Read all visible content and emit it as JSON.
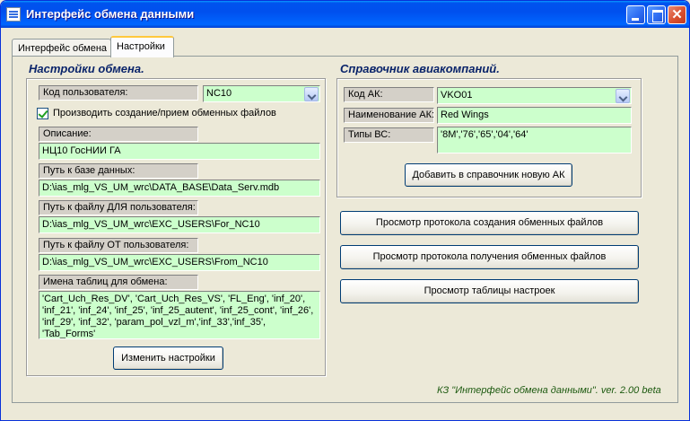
{
  "window": {
    "title": "Интерфейс обмена данными"
  },
  "tabs": [
    {
      "label": "Интерфейс обмена"
    },
    {
      "label": "Настройки"
    }
  ],
  "exchange_settings": {
    "title": "Настройки обмена.",
    "user_code_label": "Код пользователя:",
    "user_code_value": "NC10",
    "create_files_checkbox_label": "Производить создание/прием обменных файлов",
    "description_label": "Описание:",
    "description_value": "НЦ10 ГосНИИ ГА",
    "db_path_label": "Путь к базе данных:",
    "db_path_value": "D:\\ias_mlg_VS_UM_wrc\\DATA_BASE\\Data_Serv.mdb",
    "path_for_user_label": "Путь к файлу ДЛЯ пользователя:",
    "path_for_user_value": "D:\\ias_mlg_VS_UM_wrc\\EXC_USERS\\For_NC10",
    "path_from_user_label": "Путь к файлу ОТ пользователя:",
    "path_from_user_value": "D:\\ias_mlg_VS_UM_wrc\\EXC_USERS\\From_NC10",
    "tables_label": "Имена таблиц для обмена:",
    "tables_value": "'Cart_Uch_Res_DV', 'Cart_Uch_Res_VS', 'FL_Eng', 'inf_20', 'inf_21', 'inf_24', 'inf_25', 'inf_25_autent', 'inf_25_cont', 'inf_26', 'inf_29', 'inf_32', 'param_pol_vzl_m','inf_33','inf_35', 'Tab_Forms'",
    "change_button": "Изменить настройки"
  },
  "airlines": {
    "title": "Справочник авиакомпаний.",
    "code_label": "Код АК:",
    "code_value": "VKO01",
    "name_label": "Наименование АК:",
    "name_value": "Red Wings",
    "aircraft_types_label": "Типы ВС:",
    "aircraft_types_value": "'8M','76','65','04','64'",
    "add_button": "Добавить в справочник новую АК"
  },
  "actions": {
    "view_create_log": "Просмотр протокола создания обменных файлов",
    "view_receive_log": "Просмотр протокола получения обменных файлов",
    "view_settings_table": "Просмотр таблицы настроек"
  },
  "footer": "КЗ \"Интерфейс обмена данными\". ver. 2.00 beta"
}
